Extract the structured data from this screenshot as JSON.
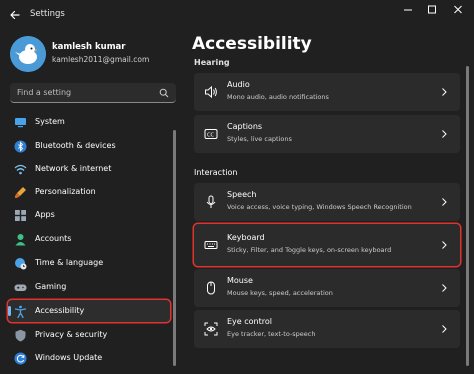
{
  "window": {
    "title": "Settings"
  },
  "user": {
    "name": "kamlesh kumar",
    "email": "kamlesh2011@gmail.com"
  },
  "search": {
    "placeholder": "Find a setting"
  },
  "sidebar": {
    "items": [
      {
        "label": "System",
        "icon": "monitor-icon"
      },
      {
        "label": "Bluetooth & devices",
        "icon": "bluetooth-icon"
      },
      {
        "label": "Network & internet",
        "icon": "wifi-icon"
      },
      {
        "label": "Personalization",
        "icon": "brush-icon"
      },
      {
        "label": "Apps",
        "icon": "apps-icon"
      },
      {
        "label": "Accounts",
        "icon": "person-icon"
      },
      {
        "label": "Time & language",
        "icon": "globe-clock-icon"
      },
      {
        "label": "Gaming",
        "icon": "gamepad-icon"
      },
      {
        "label": "Accessibility",
        "icon": "accessibility-icon",
        "selected": true
      },
      {
        "label": "Privacy & security",
        "icon": "shield-icon"
      },
      {
        "label": "Windows Update",
        "icon": "update-icon"
      }
    ]
  },
  "main": {
    "title": "Accessibility",
    "partial_section": "Hearing",
    "interaction_heading": "Interaction",
    "cards": [
      {
        "title": "Audio",
        "subtitle": "Mono audio, audio notifications",
        "icon": "speaker-icon"
      },
      {
        "title": "Captions",
        "subtitle": "Styles, live captions",
        "icon": "captions-icon"
      },
      {
        "title": "Speech",
        "subtitle": "Voice access, voice typing, Windows Speech Recognition",
        "icon": "microphone-icon"
      },
      {
        "title": "Keyboard",
        "subtitle": "Sticky, Filter, and Toggle keys, on-screen keyboard",
        "icon": "keyboard-icon",
        "highlighted": true
      },
      {
        "title": "Mouse",
        "subtitle": "Mouse keys, speed, acceleration",
        "icon": "mouse-icon"
      },
      {
        "title": "Eye control",
        "subtitle": "Eye tracker, text-to-speech",
        "icon": "eye-control-icon"
      }
    ]
  },
  "colors": {
    "background": "#202020",
    "card": "#2b2b2b",
    "accent": "#76b9ed",
    "highlight_border": "#e0322e"
  }
}
